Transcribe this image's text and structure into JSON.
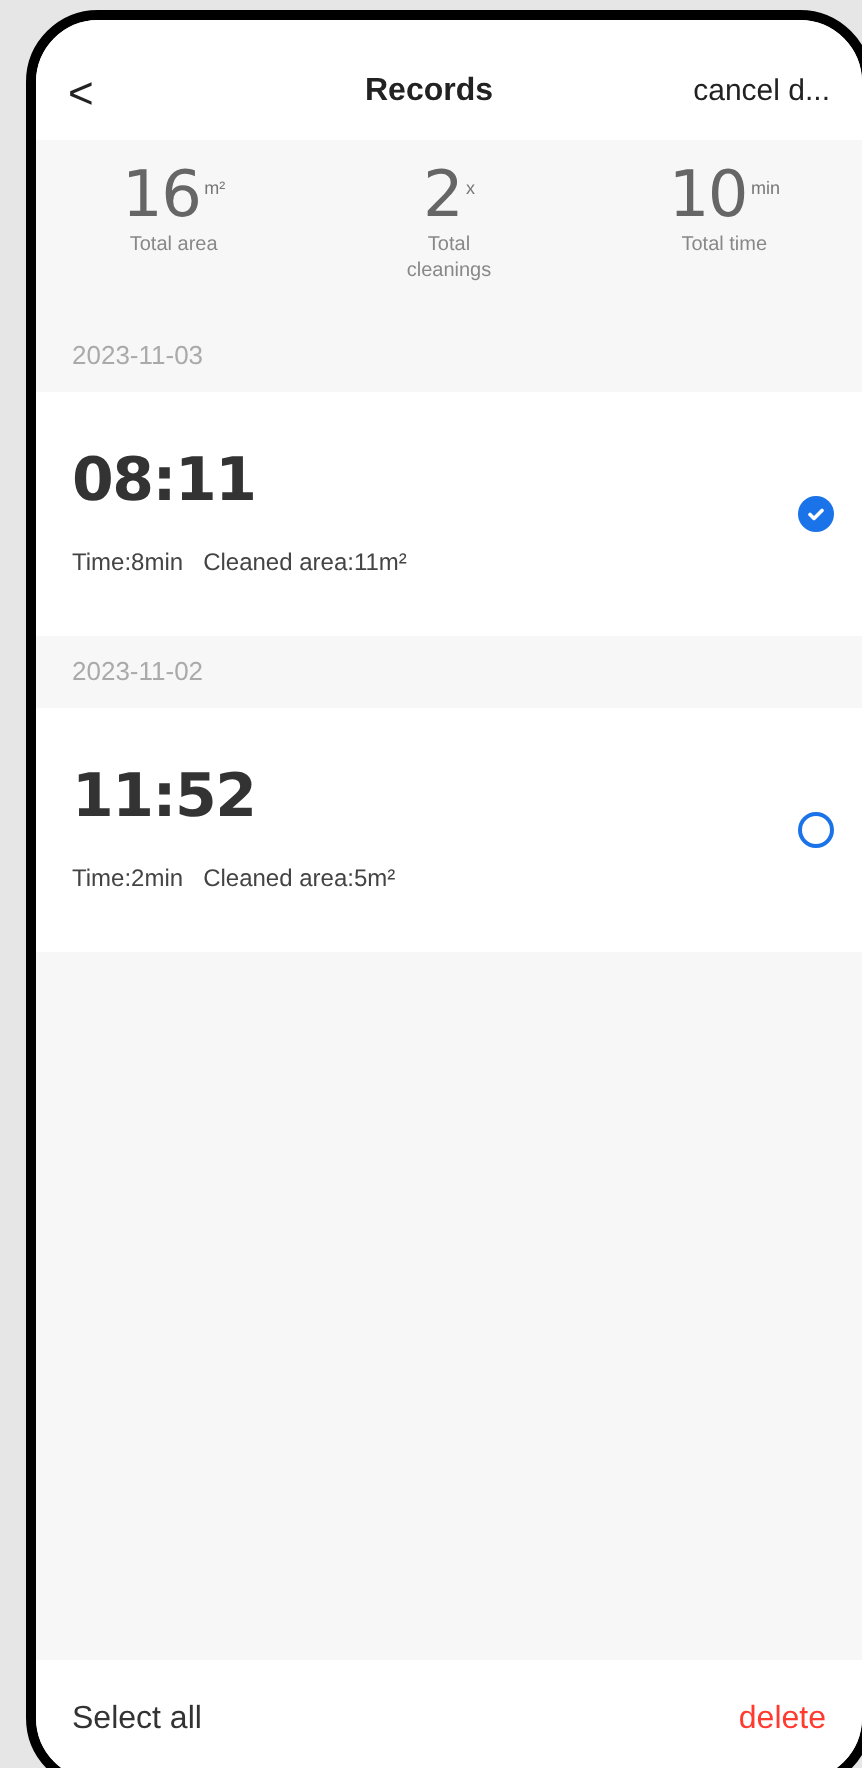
{
  "header": {
    "back": "<",
    "title": "Records",
    "action": "cancel d..."
  },
  "stats": [
    {
      "value": "16",
      "unit": "m²",
      "label": "Total area"
    },
    {
      "value": "2",
      "unit": "x",
      "label": "Total cleanings"
    },
    {
      "value": "10",
      "unit": "min",
      "label": "Total time"
    }
  ],
  "groups": [
    {
      "date": "2023-11-03",
      "records": [
        {
          "time": "08:11",
          "details": "Time:8min   Cleaned area:11m²",
          "selected": true
        }
      ]
    },
    {
      "date": "2023-11-02",
      "records": [
        {
          "time": "11:52",
          "details": "Time:2min   Cleaned area:5m²",
          "selected": false
        }
      ]
    }
  ],
  "footer": {
    "select_all": "Select all",
    "delete": "delete"
  }
}
